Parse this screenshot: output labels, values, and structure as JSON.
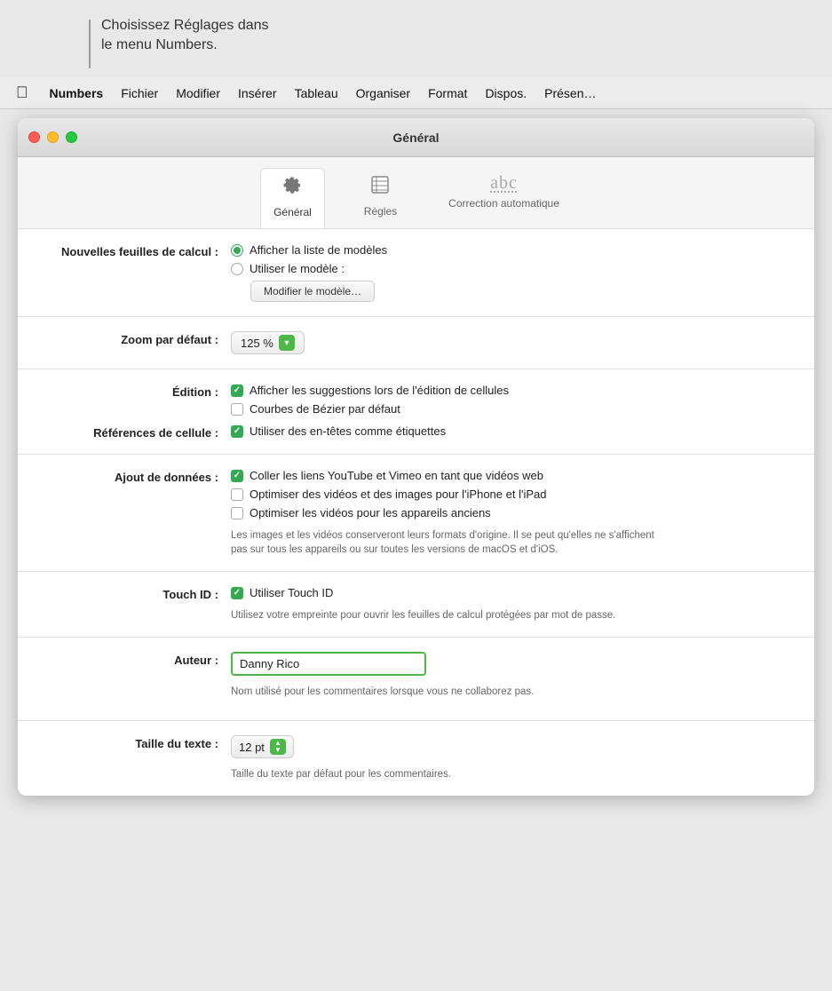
{
  "tooltip": {
    "line1": "Choisissez Réglages dans",
    "line2": "le menu Numbers."
  },
  "menubar": {
    "items": [
      {
        "id": "apple",
        "label": ""
      },
      {
        "id": "numbers",
        "label": "Numbers",
        "bold": true
      },
      {
        "id": "fichier",
        "label": "Fichier"
      },
      {
        "id": "modifier",
        "label": "Modifier"
      },
      {
        "id": "inserer",
        "label": "Insérer"
      },
      {
        "id": "tableau",
        "label": "Tableau"
      },
      {
        "id": "organiser",
        "label": "Organiser"
      },
      {
        "id": "format",
        "label": "Format"
      },
      {
        "id": "dispos",
        "label": "Dispos."
      },
      {
        "id": "presen",
        "label": "Présen…"
      }
    ]
  },
  "window": {
    "title": "Général",
    "tabs": [
      {
        "id": "general",
        "label": "Général",
        "icon": "⚙",
        "active": true
      },
      {
        "id": "regles",
        "label": "Règles",
        "icon": "📏",
        "active": false
      },
      {
        "id": "correction",
        "label": "Correction automatique",
        "icon": "abc",
        "active": false
      }
    ]
  },
  "sections": {
    "nouvelles_feuilles": {
      "label": "Nouvelles feuilles de calcul :",
      "option1": "Afficher la liste de modèles",
      "option2": "Utiliser le modèle :",
      "button": "Modifier le modèle…"
    },
    "zoom": {
      "label": "Zoom par défaut :",
      "value": "125 %"
    },
    "edition": {
      "label": "Édition :",
      "option1": "Afficher les suggestions lors de l'édition de cellules",
      "option1_checked": true,
      "option2": "Courbes de Bézier par défaut",
      "option2_checked": false
    },
    "references": {
      "label": "Références de cellule :",
      "option1": "Utiliser des en-têtes comme étiquettes",
      "option1_checked": true
    },
    "ajout_donnees": {
      "label": "Ajout de données :",
      "option1": "Coller les liens YouTube et Vimeo en tant que vidéos web",
      "option1_checked": true,
      "option2": "Optimiser des vidéos et des images pour l'iPhone et l'iPad",
      "option2_checked": false,
      "option3": "Optimiser les vidéos pour les appareils anciens",
      "option3_checked": false,
      "helper": "Les images et les vidéos conserveront leurs formats d'origine. Il se peut qu'elles ne s'affichent pas sur tous les appareils ou sur toutes les versions de macOS et d'iOS."
    },
    "touch_id": {
      "label": "Touch ID :",
      "option1": "Utiliser Touch ID",
      "option1_checked": true,
      "helper": "Utilisez votre empreinte pour ouvrir les feuilles de calcul protégées par mot de passe."
    },
    "auteur": {
      "label": "Auteur :",
      "value": "Danny Rico",
      "helper": "Nom utilisé pour les commentaires lorsque vous ne collaborez pas."
    },
    "taille_texte": {
      "label": "Taille du texte :",
      "value": "12 pt",
      "helper": "Taille du texte par défaut pour les commentaires."
    }
  }
}
